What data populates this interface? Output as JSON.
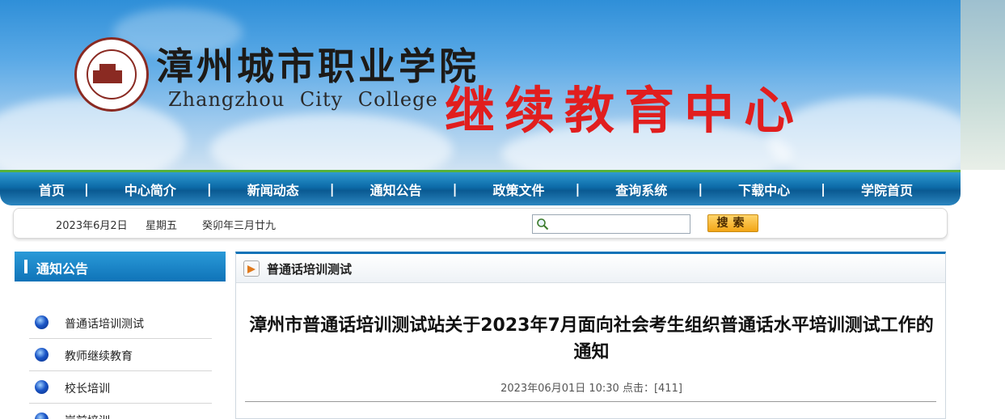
{
  "header": {
    "college_name_cn": "漳州城市职业学院",
    "college_name_en": "Zhangzhou City College",
    "center_title": "继续教育中心"
  },
  "nav": {
    "items": [
      "首页",
      "中心简介",
      "新闻动态",
      "通知公告",
      "政策文件",
      "查询系统",
      "下载中心",
      "学院首页"
    ]
  },
  "infobar": {
    "date": "2023年6月2日",
    "weekday": "星期五",
    "lunar": "癸卯年三月廿九",
    "search_placeholder": "",
    "search_button": "搜索"
  },
  "sidebar": {
    "title": "通知公告",
    "items": [
      "普通话培训测试",
      "教师继续教育",
      "校长培训",
      "岗前培训"
    ]
  },
  "main": {
    "section_title": "普通话培训测试",
    "article_title": "漳州市普通话培训测试站关于2023年7月面向社会考生组织普通话水平培训测试工作的通知",
    "meta": "2023年06月01日 10:30  点击：[411]"
  },
  "colors": {
    "nav_blue": "#0c6aa8",
    "title_red": "#e11e1e",
    "accent_green": "#55b13c"
  }
}
